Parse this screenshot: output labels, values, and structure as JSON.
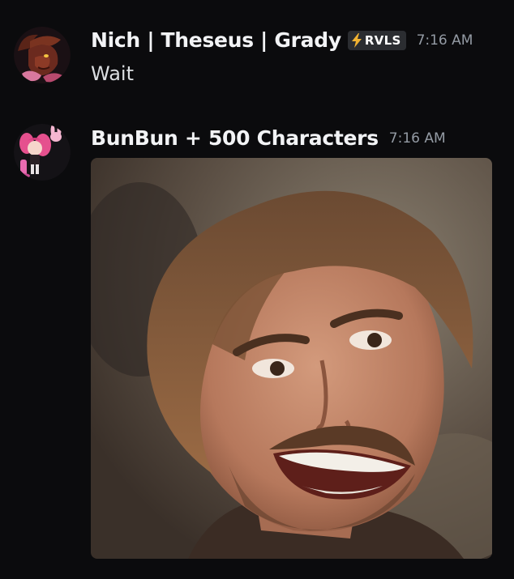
{
  "messages": [
    {
      "author": "Nich | Theseus | Grady",
      "tag": {
        "icon": "lightning-bolt-icon",
        "label": "RVLS"
      },
      "timestamp": "7:16 AM",
      "content": "Wait",
      "avatar": "avatar-dragon"
    },
    {
      "author": "BunBun + 500 Characters",
      "timestamp": "7:16 AM",
      "avatar": "avatar-pink-anime-girl",
      "attachment": "image-smiling-man"
    }
  ],
  "colors": {
    "background": "#0b0b0d",
    "username": "#f2f3f5",
    "timestamp": "#949ba4",
    "text": "#dbdee1",
    "tag_background": "#2b2d31",
    "tag_bolt": "#f0b232"
  }
}
